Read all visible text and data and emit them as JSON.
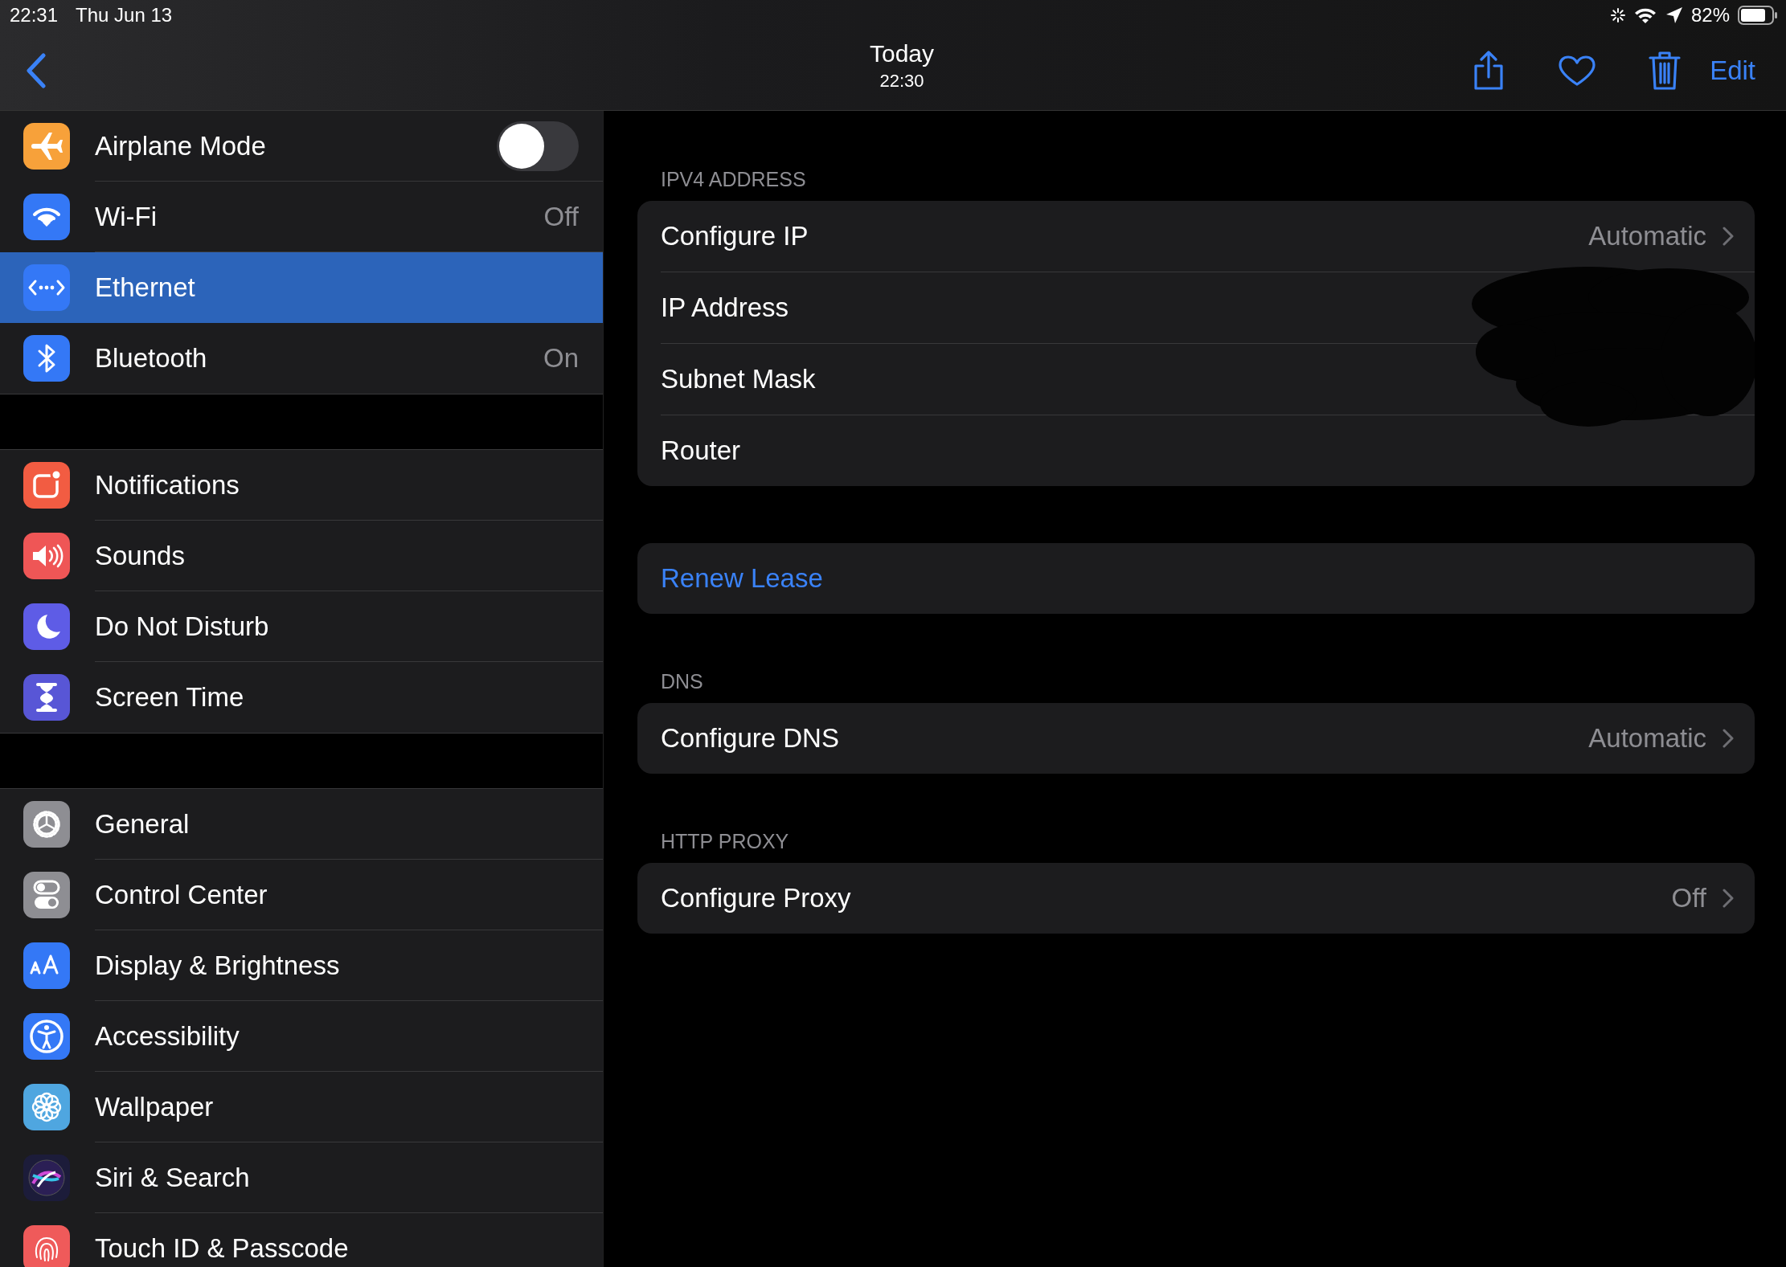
{
  "status_bar": {
    "time": "22:31",
    "date": "Thu Jun 13",
    "battery": "82%"
  },
  "nav": {
    "title": "Today",
    "subtitle": "22:30",
    "edit": "Edit"
  },
  "sidebar": {
    "groups": [
      [
        {
          "kind": "toggle",
          "label": "Airplane Mode",
          "on": false,
          "selected": false
        },
        {
          "kind": "link",
          "label": "Wi-Fi",
          "value": "Off",
          "selected": false
        },
        {
          "kind": "link",
          "label": "Ethernet",
          "selected": true
        },
        {
          "kind": "link",
          "label": "Bluetooth",
          "value": "On",
          "selected": false
        }
      ],
      [
        {
          "kind": "link",
          "label": "Notifications",
          "selected": false
        },
        {
          "kind": "link",
          "label": "Sounds",
          "selected": false
        },
        {
          "kind": "link",
          "label": "Do Not Disturb",
          "selected": false
        },
        {
          "kind": "link",
          "label": "Screen Time",
          "selected": false
        }
      ],
      [
        {
          "kind": "link",
          "label": "General",
          "selected": false
        },
        {
          "kind": "link",
          "label": "Control Center",
          "selected": false
        },
        {
          "kind": "link",
          "label": "Display & Brightness",
          "selected": false
        },
        {
          "kind": "link",
          "label": "Accessibility",
          "selected": false
        },
        {
          "kind": "link",
          "label": "Wallpaper",
          "selected": false
        },
        {
          "kind": "link",
          "label": "Siri & Search",
          "selected": false
        },
        {
          "kind": "link",
          "label": "Touch ID & Passcode",
          "selected": false
        }
      ]
    ]
  },
  "detail": {
    "sections": [
      {
        "header": "IPV4 ADDRESS",
        "redacted": true,
        "rows": [
          {
            "kind": "link",
            "label": "Configure IP",
            "value": "Automatic"
          },
          {
            "kind": "field",
            "label": "IP Address"
          },
          {
            "kind": "field",
            "label": "Subnet Mask"
          },
          {
            "kind": "field",
            "label": "Router"
          }
        ]
      },
      {
        "rows": [
          {
            "kind": "action",
            "label": "Renew Lease"
          }
        ]
      },
      {
        "header": "DNS",
        "rows": [
          {
            "kind": "link",
            "label": "Configure DNS",
            "value": "Automatic"
          }
        ]
      },
      {
        "header": "HTTP PROXY",
        "rows": [
          {
            "kind": "link",
            "label": "Configure Proxy",
            "value": "Off"
          }
        ]
      }
    ]
  }
}
